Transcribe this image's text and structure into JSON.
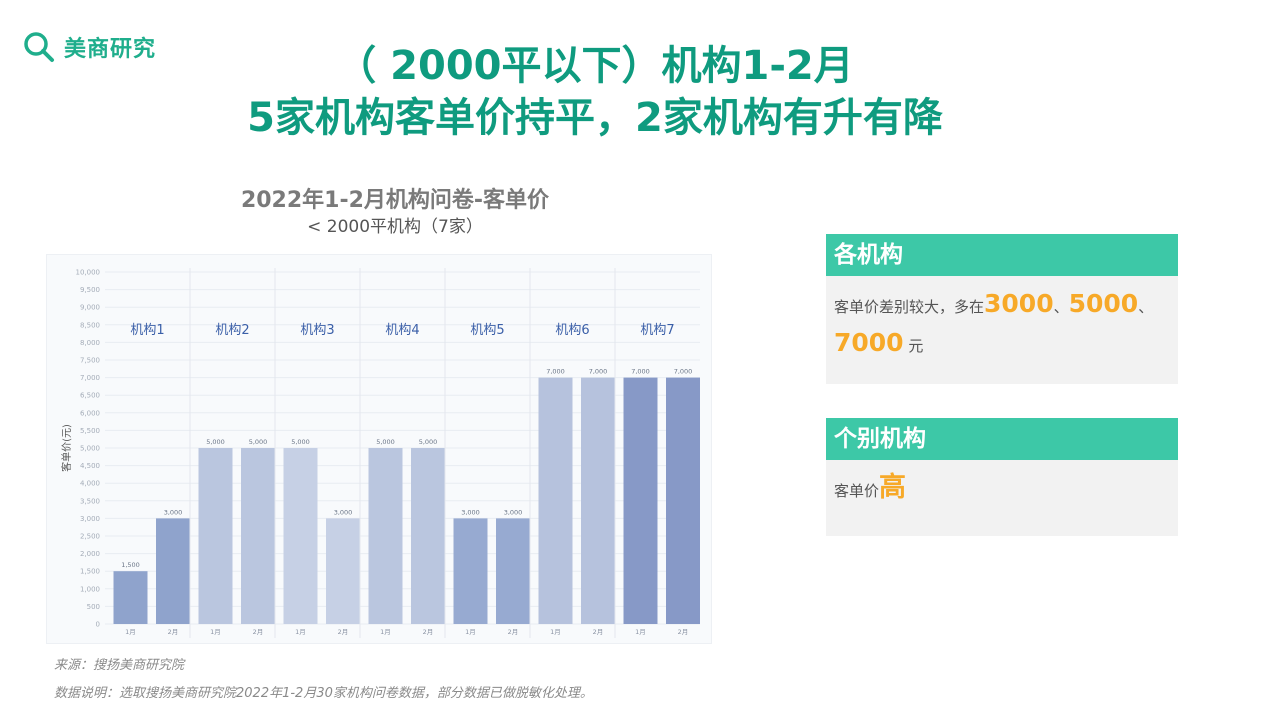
{
  "brand": {
    "name": "美商研究",
    "icon": "magnifier-icon"
  },
  "title": {
    "line1": "（ 2000平以下）机构1-2月",
    "line2": "5家机构客单价持平，2家机构有升有降"
  },
  "chart_heading": {
    "title": "2022年1-2月机构问卷-客单价",
    "subtitle": "< 2000平机构（7家）"
  },
  "chart_data": {
    "type": "bar",
    "ylabel": "客单价(元)",
    "ylim": [
      0,
      10000
    ],
    "y_ticks": [
      0,
      500,
      1000,
      1500,
      2000,
      2500,
      3000,
      3500,
      4000,
      4500,
      5000,
      5500,
      6000,
      6500,
      7000,
      7500,
      8000,
      8500,
      9000,
      9500,
      10000
    ],
    "y_tick_labels": [
      "0",
      "500",
      "1,000",
      "1,500",
      "2,000",
      "2,500",
      "3,000",
      "3,500",
      "4,000",
      "4,500",
      "5,000",
      "5,500",
      "6,000",
      "6,500",
      "7,000",
      "7,500",
      "8,000",
      "8,500",
      "9,000",
      "9,500",
      "10,000"
    ],
    "grid": true,
    "groups": [
      {
        "label": "机构1",
        "bars": [
          {
            "x": "1月",
            "value": 1500,
            "label": "1,500",
            "color": "#8fa3cc"
          },
          {
            "x": "2月",
            "value": 3000,
            "label": "3,000",
            "color": "#8fa3cc"
          }
        ]
      },
      {
        "label": "机构2",
        "bars": [
          {
            "x": "1月",
            "value": 5000,
            "label": "5,000",
            "color": "#bac6df"
          },
          {
            "x": "2月",
            "value": 5000,
            "label": "5,000",
            "color": "#bac6df"
          }
        ]
      },
      {
        "label": "机构3",
        "bars": [
          {
            "x": "1月",
            "value": 5000,
            "label": "5,000",
            "color": "#c6d0e5"
          },
          {
            "x": "2月",
            "value": 3000,
            "label": "3,000",
            "color": "#c6d0e5"
          }
        ]
      },
      {
        "label": "机构4",
        "bars": [
          {
            "x": "1月",
            "value": 5000,
            "label": "5,000",
            "color": "#bac6df"
          },
          {
            "x": "2月",
            "value": 5000,
            "label": "5,000",
            "color": "#bac6df"
          }
        ]
      },
      {
        "label": "机构5",
        "bars": [
          {
            "x": "1月",
            "value": 3000,
            "label": "3,000",
            "color": "#97aad1"
          },
          {
            "x": "2月",
            "value": 3000,
            "label": "3,000",
            "color": "#97aad1"
          }
        ]
      },
      {
        "label": "机构6",
        "bars": [
          {
            "x": "1月",
            "value": 7000,
            "label": "7,000",
            "color": "#b6c2dd"
          },
          {
            "x": "2月",
            "value": 7000,
            "label": "7,000",
            "color": "#b6c2dd"
          }
        ]
      },
      {
        "label": "机构7",
        "bars": [
          {
            "x": "1月",
            "value": 7000,
            "label": "7,000",
            "color": "#8799c7"
          },
          {
            "x": "2月",
            "value": 7000,
            "label": "7,000",
            "color": "#8799c7"
          }
        ]
      }
    ]
  },
  "panels": [
    {
      "title": "各机构",
      "text_prefix": "客单价差别较大，多在",
      "v1": "3000",
      "sep1": "、",
      "v2": "5000",
      "sep2": "、",
      "v3": "7000",
      "unit": " 元"
    },
    {
      "title": "个别机构",
      "text_prefix": "客单价",
      "highlight": "高"
    }
  ],
  "footer": {
    "source": "来源：搜扬美商研究院",
    "note": "数据说明：选取搜扬美商研究院2022年1-2月30家机构问卷数据，部分数据已做脱敏化处理。"
  },
  "colors": {
    "accent": "#0f9b7f",
    "panel_head": "#3dc8a7",
    "highlight": "#f7a928",
    "group_label": "#3a5fa8"
  }
}
